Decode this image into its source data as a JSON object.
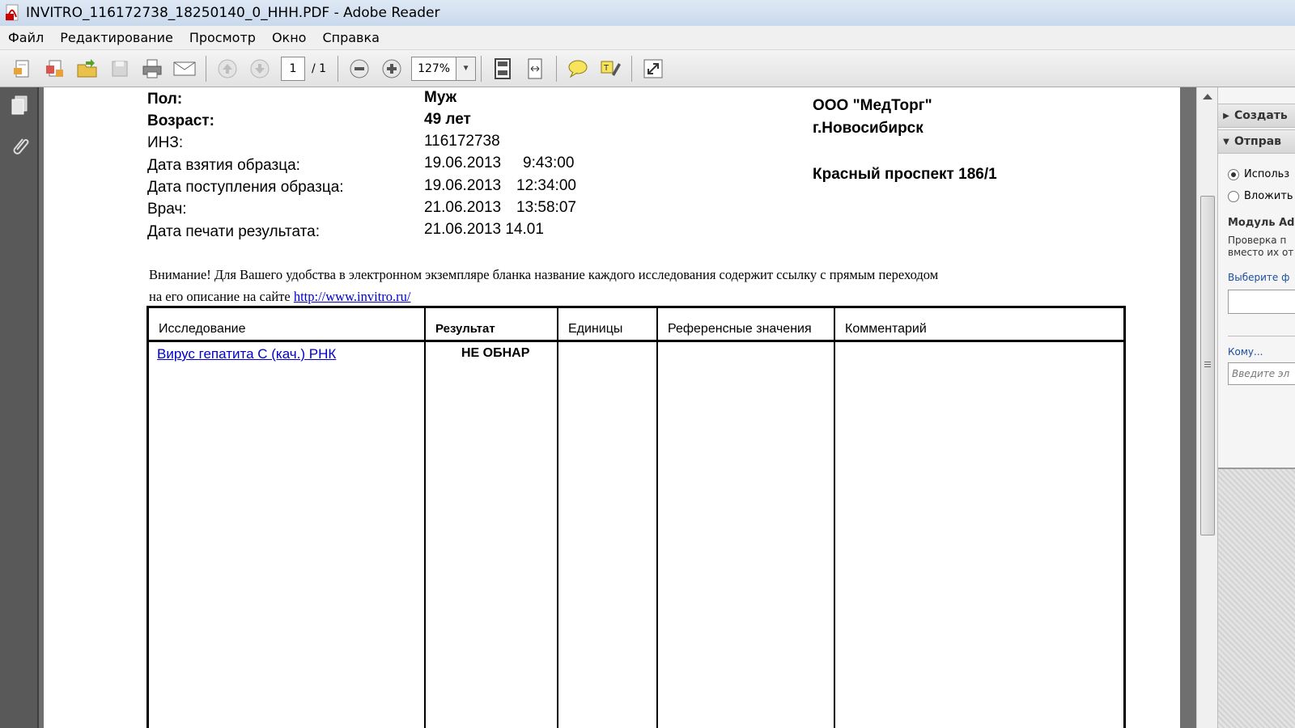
{
  "window": {
    "title": "INVITRO_116172738_18250140_0_HHH.PDF - Adobe Reader"
  },
  "menu": [
    "Файл",
    "Редактирование",
    "Просмотр",
    "Окно",
    "Справка"
  ],
  "toolbar": {
    "page_current": "1",
    "page_total": "/ 1",
    "zoom": "127%"
  },
  "document": {
    "patient": {
      "sex_label": "Пол:",
      "sex_value": "Муж",
      "age_label": "Возраст:",
      "age_value": "49 лет",
      "inz_label": "ИНЗ:",
      "inz_value": "116172738",
      "sample_taken_label": "Дата взятия образца:",
      "sample_taken_date": "19.06.2013",
      "sample_taken_time": "9:43:00",
      "sample_received_label": "Дата поступления образца:",
      "sample_received_date": "19.06.2013",
      "sample_received_time": "12:34:00",
      "doctor_label": "Врач:",
      "doctor_date": "21.06.2013",
      "doctor_time": "13:58:07",
      "print_label": "Дата печати результата:",
      "print_value": "21.06.2013 14.01"
    },
    "org": {
      "name": "ООО \"МедТорг\"",
      "city": "г.Новосибирск",
      "address": "Красный проспект 186/1"
    },
    "notice_line1": "Внимание! Для Вашего удобства в электронном экземпляре бланка название каждого исследования содержит ссылку с прямым переходом",
    "notice_line2_prefix": "на его описание на сайте",
    "notice_link": "http://www.invitro.ru/",
    "table": {
      "headers": [
        "Исследование",
        "Результат",
        "Единицы",
        "Референсные значения",
        "Комментарий"
      ],
      "rows": [
        {
          "test": "Вирус гепатита С (кач.) РНК",
          "result": "НЕ ОБНАР",
          "units": "",
          "reference": "",
          "comment": ""
        }
      ]
    }
  },
  "right_pane": {
    "section1": "Создать",
    "section2": "Отправ",
    "radio1": "Использ",
    "radio2": "Вложить",
    "module_title": "Модуль Ad",
    "desc_line1": "Проверка п",
    "desc_line2": "вместо их от",
    "choose_label": "Выберите ф",
    "to_label": "Кому...",
    "email_placeholder": "Введите эл"
  }
}
